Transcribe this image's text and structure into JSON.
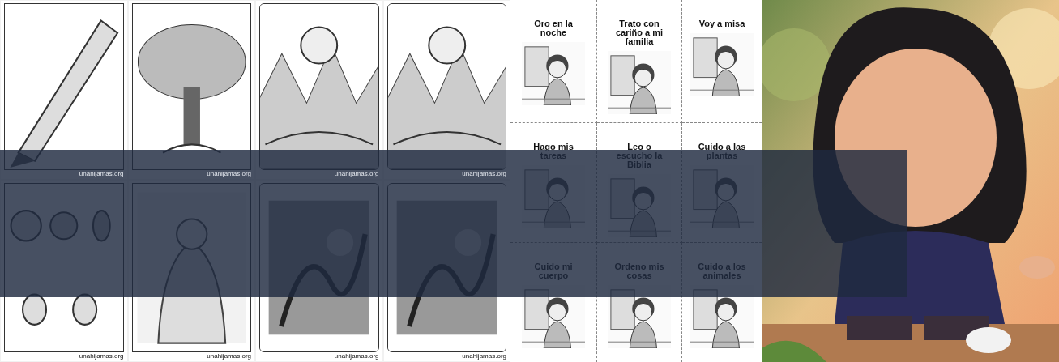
{
  "coloring_pages": [
    {
      "footer": "unahijamas.org"
    },
    {
      "footer": "unahijamas.org"
    },
    {
      "footer": "unahijamas.org"
    },
    {
      "footer": "unahijamas.org"
    },
    {
      "footer": "unahijamas.org"
    },
    {
      "footer": "unahijamas.org"
    },
    {
      "footer": "unahijamas.org"
    },
    {
      "footer": "unahijamas.org"
    }
  ],
  "worksheet": {
    "cards": [
      {
        "title": "Oro en la noche"
      },
      {
        "title": "Trato con cariño a mi familia"
      },
      {
        "title": "Voy a misa"
      },
      {
        "title": "Hago mis tareas"
      },
      {
        "title": "Leo o escucho la Biblia"
      },
      {
        "title": "Cuido a las plantas"
      },
      {
        "title": "Cuido mi cuerpo"
      },
      {
        "title": "Ordeno mis cosas"
      },
      {
        "title": "Cuido a los animales"
      }
    ]
  }
}
